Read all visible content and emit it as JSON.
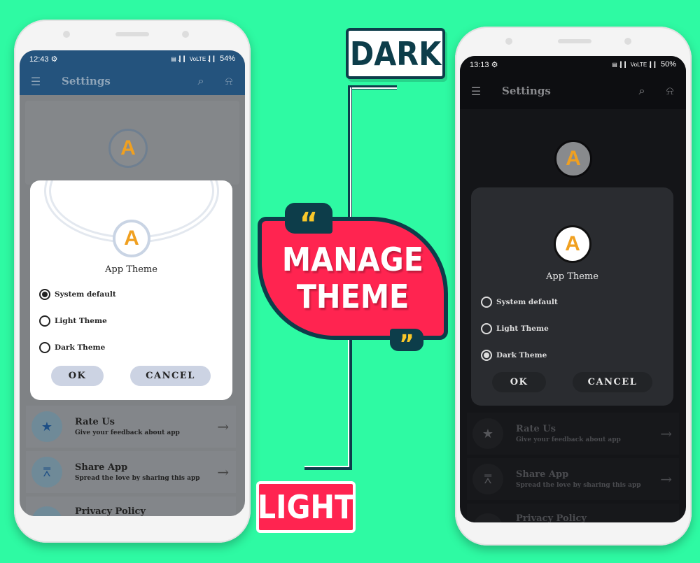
{
  "colors": {
    "background": "#2efaa3",
    "accent_red": "#ff2450",
    "dark_teal": "#0d3d4a",
    "quote_yellow": "#f8c72a"
  },
  "callouts": {
    "dark": "DARK",
    "light": "LIGHT",
    "manage_line1": "MANAGE",
    "manage_line2": "THEME",
    "open_quote": "“",
    "close_quote": "”"
  },
  "light_phone": {
    "status": {
      "time": "12:43",
      "battery": "54%",
      "signal": "▤ .▎▎ VoLTE .▎▎"
    },
    "header": {
      "title": "Settings",
      "menu_icon": "☰",
      "search_icon": "⌕",
      "bell_icon": "⍾"
    },
    "logo_letter": "A",
    "dialog": {
      "title": "App Theme",
      "options": [
        "System default",
        "Light Theme",
        "Dark Theme"
      ],
      "selected": 0,
      "ok": "OK",
      "cancel": "CANCEL"
    },
    "items": [
      {
        "title": "Rate Us",
        "subtitle": "Give your feedback about app",
        "icon": "★"
      },
      {
        "title": "Share App",
        "subtitle": "Spread the love by sharing this app",
        "icon": "⩞"
      },
      {
        "title": "Privacy Policy",
        "subtitle": "",
        "icon": "⌂"
      }
    ],
    "arrow": "→"
  },
  "dark_phone": {
    "status": {
      "time": "13:13",
      "battery": "50%",
      "signal": "▤ .▎▎ VoLTE .▎▎"
    },
    "header": {
      "title": "Settings",
      "menu_icon": "☰",
      "search_icon": "⌕",
      "bell_icon": "⍾"
    },
    "logo_letter": "A",
    "dialog": {
      "title": "App Theme",
      "options": [
        "System default",
        "Light Theme",
        "Dark Theme"
      ],
      "selected": 2,
      "ok": "OK",
      "cancel": "CANCEL"
    },
    "items": [
      {
        "title": "Rate Us",
        "subtitle": "Give your feedback about app",
        "icon": "★"
      },
      {
        "title": "Share App",
        "subtitle": "Spread the love by sharing this app",
        "icon": "⩞"
      },
      {
        "title": "Privacy Policy",
        "subtitle": "",
        "icon": "⌂"
      }
    ],
    "arrow": "→"
  }
}
